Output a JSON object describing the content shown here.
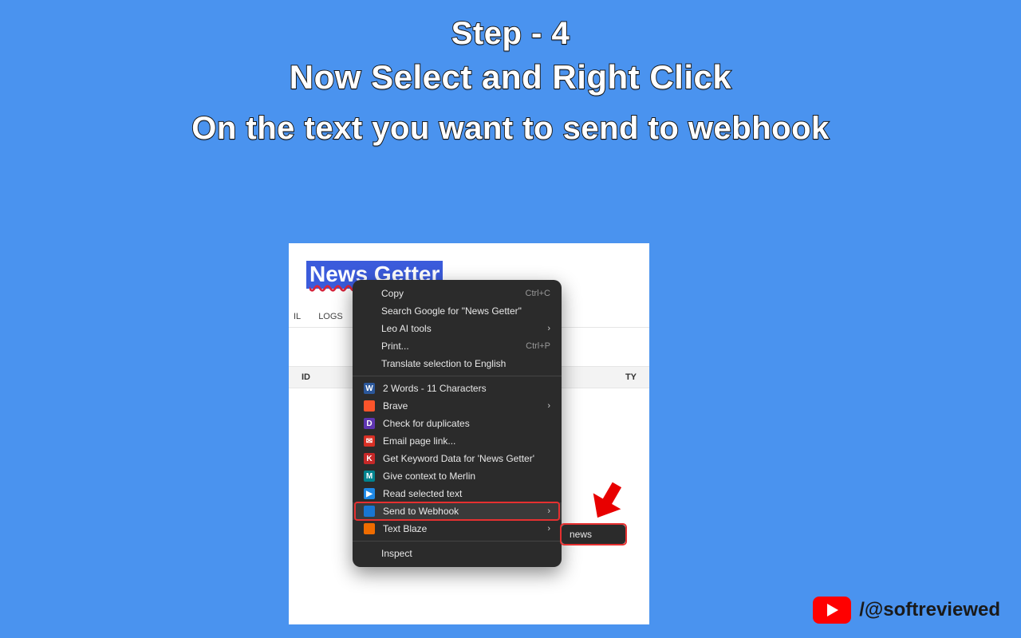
{
  "headings": {
    "step": "Step - 4",
    "line1": "Now Select and Right Click",
    "line2": "On the text you want to send to webhook"
  },
  "page": {
    "selected_text": "News Getter",
    "tabs": {
      "il": "IL",
      "logs": "LOGS"
    },
    "columns": {
      "id": "ID",
      "type": "TY"
    }
  },
  "context_menu": {
    "copy": {
      "label": "Copy",
      "shortcut": "Ctrl+C"
    },
    "search": {
      "label": "Search Google for \"News Getter\""
    },
    "leo": {
      "label": "Leo AI tools"
    },
    "print": {
      "label": "Print...",
      "shortcut": "Ctrl+P"
    },
    "translate": {
      "label": "Translate selection to English"
    },
    "words": {
      "label": "2 Words - 11 Characters"
    },
    "brave": {
      "label": "Brave"
    },
    "dup": {
      "label": "Check for duplicates"
    },
    "email": {
      "label": "Email page link..."
    },
    "keyword": {
      "label": "Get Keyword Data for 'News Getter'"
    },
    "merlin": {
      "label": "Give context to Merlin"
    },
    "read": {
      "label": "Read selected text"
    },
    "webhook": {
      "label": "Send to Webhook"
    },
    "blaze": {
      "label": "Text Blaze"
    },
    "inspect": {
      "label": "Inspect"
    }
  },
  "submenu": {
    "item": "news"
  },
  "footer": {
    "handle": "/@softreviewed"
  },
  "icons": {
    "w": "W",
    "brave": "",
    "d": "D",
    "email": "✉",
    "k": "K",
    "merlin": "M",
    "play": "▶",
    "send": "",
    "blaze": ""
  }
}
